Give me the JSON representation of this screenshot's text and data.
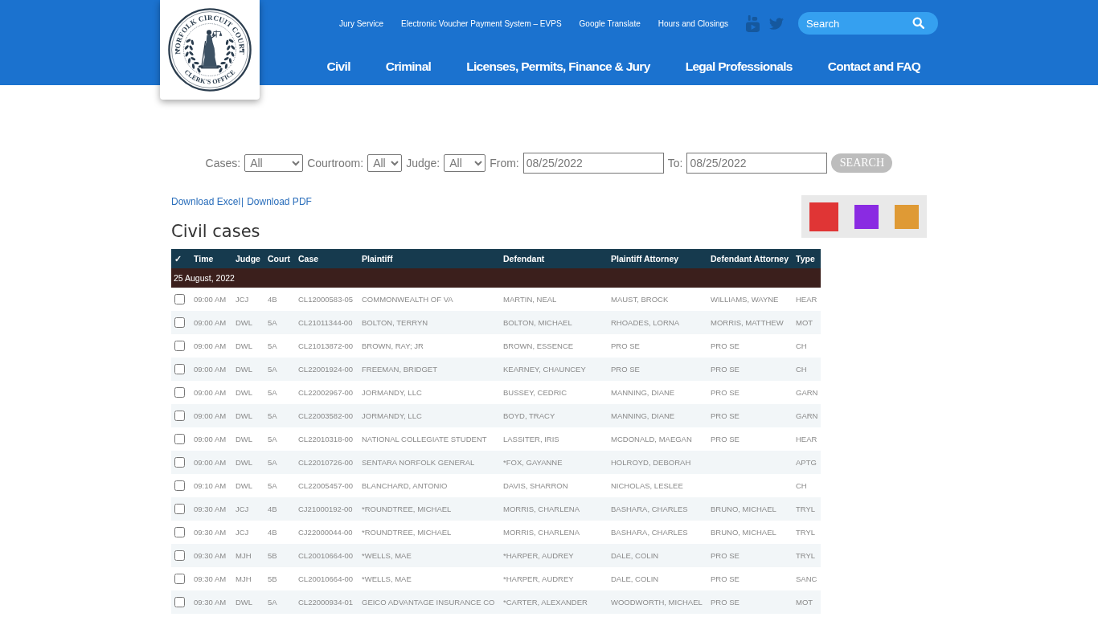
{
  "header": {
    "logo": {
      "top_text": "NORFOLK CIRCUIT COURT",
      "bottom_text": "CLERK'S OFFICE"
    },
    "top_links": [
      "Jury Service",
      "Electronic Voucher Payment System – EVPS",
      "Google Translate",
      "Hours and Closings"
    ],
    "social_links": [
      {
        "kind": "youtube"
      },
      {
        "kind": "twitter"
      }
    ],
    "search": {
      "placeholder": "Search"
    },
    "main_nav": [
      "Civil",
      "Criminal",
      "Licenses, Permits, Finance & Jury",
      "Legal Professionals",
      "Contact and FAQ"
    ]
  },
  "filters": [
    {
      "kind": "select",
      "label": "Cases:",
      "value": "All"
    },
    {
      "kind": "select",
      "label": "Courtroom:",
      "value": "All"
    },
    {
      "kind": "select",
      "label": "Judge:",
      "value": "All"
    },
    {
      "kind": "date",
      "label": "From:",
      "value": "08/25/2022"
    },
    {
      "kind": "date",
      "label": "To:",
      "value": "08/25/2022"
    }
  ],
  "search_button": "SEARCH",
  "downloads": [
    "Download Excel",
    "Download PDF"
  ],
  "download_separator": "|",
  "legend_swatches": [
    {
      "color": "#e03535",
      "selected": true
    },
    {
      "color": "#8a2be2",
      "selected": false
    },
    {
      "color": "#df9a35",
      "selected": false
    }
  ],
  "title": "Civil cases",
  "table": {
    "columns": [
      "✓",
      "Time",
      "Judge",
      "Court",
      "Case",
      "Plaintiff",
      "Defendant",
      "Plaintiff Attorney",
      "Defendant Attorney",
      "Type"
    ],
    "groups": [
      {
        "date": "25 August, 2022",
        "rows": [
          {
            "checked": false,
            "time": "09:00 AM",
            "judge": "JCJ",
            "court": "4B",
            "case": "CL12000583-05",
            "plaintiff": "COMMONWEALTH OF VA",
            "defendant": "MARTIN, NEAL",
            "plaintiff_attorney": "MAUST, BROCK",
            "defendant_attorney": "WILLIAMS, WAYNE",
            "type": "HEAR"
          },
          {
            "checked": false,
            "time": "09:00 AM",
            "judge": "DWL",
            "court": "5A",
            "case": "CL21011344-00",
            "plaintiff": "BOLTON, TERRYN",
            "defendant": "BOLTON, MICHAEL",
            "plaintiff_attorney": "RHOADES, LORNA",
            "defendant_attorney": "MORRIS, MATTHEW",
            "type": "MOT"
          },
          {
            "checked": false,
            "time": "09:00 AM",
            "judge": "DWL",
            "court": "5A",
            "case": "CL21013872-00",
            "plaintiff": "BROWN, RAY; JR",
            "defendant": "BROWN, ESSENCE",
            "plaintiff_attorney": "PRO SE",
            "defendant_attorney": "PRO SE",
            "type": "CH"
          },
          {
            "checked": false,
            "time": "09:00 AM",
            "judge": "DWL",
            "court": "5A",
            "case": "CL22001924-00",
            "plaintiff": "FREEMAN, BRIDGET",
            "defendant": "KEARNEY, CHAUNCEY",
            "plaintiff_attorney": "PRO SE",
            "defendant_attorney": "PRO SE",
            "type": "CH"
          },
          {
            "checked": false,
            "time": "09:00 AM",
            "judge": "DWL",
            "court": "5A",
            "case": "CL22002967-00",
            "plaintiff": "JORMANDY, LLC",
            "defendant": "BUSSEY, CEDRIC",
            "plaintiff_attorney": "MANNING, DIANE",
            "defendant_attorney": "PRO SE",
            "type": "GARN"
          },
          {
            "checked": false,
            "time": "09:00 AM",
            "judge": "DWL",
            "court": "5A",
            "case": "CL22003582-00",
            "plaintiff": "JORMANDY, LLC",
            "defendant": "BOYD, TRACY",
            "plaintiff_attorney": "MANNING, DIANE",
            "defendant_attorney": "PRO SE",
            "type": "GARN"
          },
          {
            "checked": false,
            "time": "09:00 AM",
            "judge": "DWL",
            "court": "5A",
            "case": "CL22010318-00",
            "plaintiff": "NATIONAL COLLEGIATE STUDENT",
            "defendant": "LASSITER, IRIS",
            "plaintiff_attorney": "MCDONALD, MAEGAN",
            "defendant_attorney": "PRO SE",
            "type": "HEAR"
          },
          {
            "checked": false,
            "time": "09:00 AM",
            "judge": "DWL",
            "court": "5A",
            "case": "CL22010726-00",
            "plaintiff": "SENTARA NORFOLK GENERAL",
            "defendant": "*FOX, GAYANNE",
            "plaintiff_attorney": "HOLROYD, DEBORAH",
            "type": "APTG"
          },
          {
            "checked": false,
            "time": "09:10 AM",
            "judge": "DWL",
            "court": "5A",
            "case": "CL22005457-00",
            "plaintiff": "BLANCHARD, ANTONIO",
            "defendant": "DAVIS, SHARRON",
            "plaintiff_attorney": "NICHOLAS, LESLEE",
            "type": "CH"
          },
          {
            "checked": false,
            "time": "09:30 AM",
            "judge": "JCJ",
            "court": "4B",
            "case": "CJ21000192-00",
            "plaintiff": "*ROUNDTREE, MICHAEL",
            "defendant": "MORRIS, CHARLENA",
            "plaintiff_attorney": "BASHARA, CHARLES",
            "defendant_attorney": "BRUNO, MICHAEL",
            "type": "TRYL"
          },
          {
            "checked": false,
            "time": "09:30 AM",
            "judge": "JCJ",
            "court": "4B",
            "case": "CJ22000044-00",
            "plaintiff": "*ROUNDTREE, MICHAEL",
            "defendant": "MORRIS, CHARLENA",
            "plaintiff_attorney": "BASHARA, CHARLES",
            "defendant_attorney": "BRUNO, MICHAEL",
            "type": "TRYL"
          },
          {
            "checked": false,
            "time": "09:30 AM",
            "judge": "MJH",
            "court": "5B",
            "case": "CL20010664-00",
            "plaintiff": "*WELLS, MAE",
            "defendant": "*HARPER, AUDREY",
            "plaintiff_attorney": "DALE, COLIN",
            "defendant_attorney": "PRO SE",
            "type": "TRYL"
          },
          {
            "checked": false,
            "time": "09:30 AM",
            "judge": "MJH",
            "court": "5B",
            "case": "CL20010664-00",
            "plaintiff": "*WELLS, MAE",
            "defendant": "*HARPER, AUDREY",
            "plaintiff_attorney": "DALE, COLIN",
            "defendant_attorney": "PRO SE",
            "type": "SANC"
          },
          {
            "checked": false,
            "time": "09:30 AM",
            "judge": "DWL",
            "court": "5A",
            "case": "CL22000934-01",
            "plaintiff": "GEICO ADVANTAGE INSURANCE CO",
            "defendant": "*CARTER, ALEXANDER",
            "plaintiff_attorney": "WOODWORTH, MICHAEL",
            "defendant_attorney": "PRO SE",
            "type": "MOT"
          }
        ]
      }
    ]
  }
}
